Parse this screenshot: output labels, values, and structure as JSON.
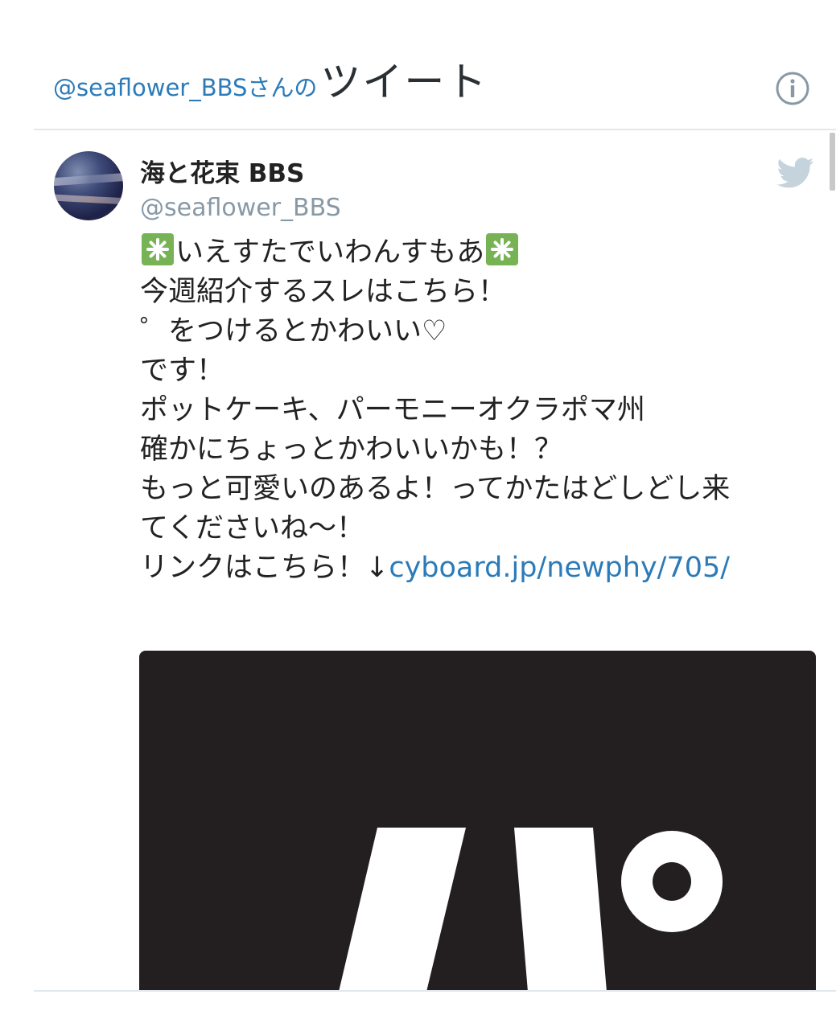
{
  "header": {
    "handle": "@seaflower_BBS",
    "suffix": "さんの",
    "title": "ツイート",
    "info_icon": "info-icon"
  },
  "tweet": {
    "display_name": "海と花束 BBS",
    "screen_name": "@seaflower_BBS",
    "avatar_icon": "avatar-image",
    "source_icon": "twitter-bird-icon",
    "text_lines": [
      "いえすたでいわんすもあ",
      "今週紹介するスレはこちら！",
      "゜をつけるとかわいい♡",
      "です！",
      "ポットケーキ、パーモニーオクラポマ州",
      "確かにちょっとかわいいかも！？",
      "もっと可愛いのあるよ！ってかたはどしどし来",
      "てくださいね〜！",
      "リンクはこちら！↓"
    ],
    "link": "cyboard.jp/newphy/705/",
    "emoji_icon": "sparkle-emoji-icon",
    "media_icon": "media-image"
  },
  "colors": {
    "link": "#2b7bb9",
    "muted": "#8899a6",
    "divider": "#e1e8ed",
    "media_bg": "#231f20",
    "emoji_bg": "#77b255"
  }
}
